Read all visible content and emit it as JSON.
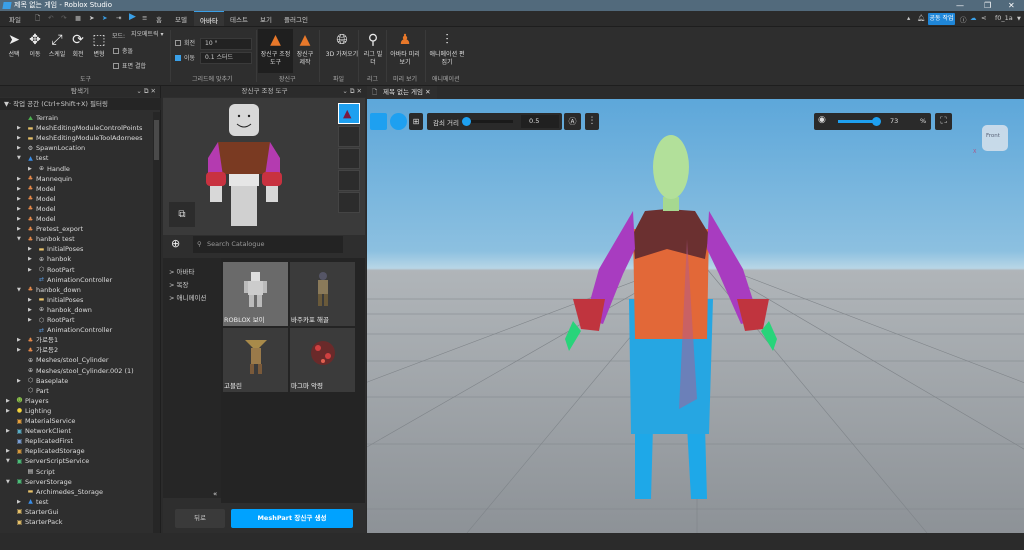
{
  "window": {
    "title": "제목 없는 게임 - Roblox Studio",
    "minimize": "—",
    "restore": "❐",
    "close": "✕"
  },
  "menu": {
    "file": "파일",
    "home": "홈",
    "tabs": [
      "모델",
      "아바타",
      "테스트",
      "보기",
      "플러그인"
    ],
    "active_tab": "아바타",
    "collab": "공동 작업",
    "user": "f0_1a"
  },
  "ribbon": {
    "tools": [
      "선택",
      "이동",
      "스케일",
      "회전",
      "변형"
    ],
    "mode_label": "모드:",
    "mode_value": "지오메트릭",
    "collision": "충돌",
    "surface_join": "표면 결합",
    "group_tools": "도구",
    "rotate_label": "회전",
    "rotate_value": "10 °",
    "rotate_checked": false,
    "move_label": "이동",
    "move_value": "0.1 스터드",
    "move_checked": true,
    "group_grid": "그리드에 맞추기",
    "accessory_fit": "장신구 조정 도구",
    "accessory_create": "장신구 제작",
    "group_accessory": "장신구",
    "import3d": "3D 가져오기",
    "group_file": "파일",
    "rig_builder": "리그 빌더",
    "group_rig": "리그",
    "avatar_preview": "아바타 미리 보기",
    "group_preview": "미리 보기",
    "anim_editor": "애니메이션 편집기",
    "group_anim": "애니메이션"
  },
  "explorer": {
    "title": "탐색기",
    "filter": "작업 공간 (Ctrl+Shift+X) 필터링",
    "items": [
      {
        "label": "Terrain",
        "level": 1,
        "arrow": "",
        "icon": "terrain",
        "color": "#4caf50"
      },
      {
        "label": "MeshEditingModuleControlPoints",
        "level": 1,
        "arrow": "right",
        "icon": "folder",
        "color": "#e8c26a"
      },
      {
        "label": "MeshEditingModuleToolAdornees",
        "level": 1,
        "arrow": "right",
        "icon": "folder",
        "color": "#e8c26a"
      },
      {
        "label": "SpawnLocation",
        "level": 1,
        "arrow": "right",
        "icon": "gear",
        "color": "#cccccc"
      },
      {
        "label": "test",
        "level": 1,
        "arrow": "down",
        "icon": "accessory",
        "color": "#3a8ee8"
      },
      {
        "label": "Handle",
        "level": 2,
        "arrow": "right",
        "icon": "mesh",
        "color": "#cccccc"
      },
      {
        "label": "Mannequin",
        "level": 1,
        "arrow": "right",
        "icon": "model",
        "color": "#e88a4a"
      },
      {
        "label": "Model",
        "level": 1,
        "arrow": "right",
        "icon": "model",
        "color": "#e88a4a"
      },
      {
        "label": "Model",
        "level": 1,
        "arrow": "right",
        "icon": "model",
        "color": "#e88a4a"
      },
      {
        "label": "Model",
        "level": 1,
        "arrow": "right",
        "icon": "model",
        "color": "#e88a4a"
      },
      {
        "label": "Model",
        "level": 1,
        "arrow": "right",
        "icon": "model",
        "color": "#e88a4a"
      },
      {
        "label": "Pretest_export",
        "level": 1,
        "arrow": "right",
        "icon": "model",
        "color": "#e88a4a"
      },
      {
        "label": "hanbok test",
        "level": 1,
        "arrow": "down",
        "icon": "model",
        "color": "#e88a4a"
      },
      {
        "label": "InitialPoses",
        "level": 2,
        "arrow": "right",
        "icon": "folder",
        "color": "#e8c26a"
      },
      {
        "label": "hanbok",
        "level": 2,
        "arrow": "right",
        "icon": "mesh",
        "color": "#cccccc"
      },
      {
        "label": "RootPart",
        "level": 2,
        "arrow": "right",
        "icon": "part",
        "color": "#cccccc"
      },
      {
        "label": "AnimationController",
        "level": 2,
        "arrow": "",
        "icon": "anim",
        "color": "#5a9ae0"
      },
      {
        "label": "hanbok_down",
        "level": 1,
        "arrow": "down",
        "icon": "model",
        "color": "#e88a4a"
      },
      {
        "label": "InitialPoses",
        "level": 2,
        "arrow": "right",
        "icon": "folder",
        "color": "#e8c26a"
      },
      {
        "label": "hanbok_down",
        "level": 2,
        "arrow": "right",
        "icon": "mesh",
        "color": "#cccccc"
      },
      {
        "label": "RootPart",
        "level": 2,
        "arrow": "right",
        "icon": "part",
        "color": "#cccccc"
      },
      {
        "label": "AnimationController",
        "level": 2,
        "arrow": "",
        "icon": "anim",
        "color": "#5a9ae0"
      },
      {
        "label": "가로등1",
        "level": 1,
        "arrow": "right",
        "icon": "model",
        "color": "#e88a4a"
      },
      {
        "label": "가로등2",
        "level": 1,
        "arrow": "right",
        "icon": "model",
        "color": "#e88a4a"
      },
      {
        "label": "Meshes/stool_Cylinder",
        "level": 1,
        "arrow": "",
        "icon": "mesh",
        "color": "#cccccc"
      },
      {
        "label": "Meshes/stool_Cylinder.002 (1)",
        "level": 1,
        "arrow": "",
        "icon": "mesh",
        "color": "#cccccc"
      },
      {
        "label": "Baseplate",
        "level": 1,
        "arrow": "right",
        "icon": "part",
        "color": "#cccccc"
      },
      {
        "label": "Part",
        "level": 1,
        "arrow": "",
        "icon": "part",
        "color": "#cccccc"
      },
      {
        "label": "Players",
        "level": 0,
        "arrow": "right",
        "icon": "players",
        "color": "#8bc34a"
      },
      {
        "label": "Lighting",
        "level": 0,
        "arrow": "right",
        "icon": "bulb",
        "color": "#f2d23c"
      },
      {
        "label": "MaterialService",
        "level": 0,
        "arrow": "",
        "icon": "service",
        "color": "#e8a23c"
      },
      {
        "label": "NetworkClient",
        "level": 0,
        "arrow": "right",
        "icon": "service",
        "color": "#5ab0c8"
      },
      {
        "label": "ReplicatedFirst",
        "level": 0,
        "arrow": "",
        "icon": "service",
        "color": "#7aa0d8"
      },
      {
        "label": "ReplicatedStorage",
        "level": 0,
        "arrow": "right",
        "icon": "service",
        "color": "#d89a3c"
      },
      {
        "label": "ServerScriptService",
        "level": 0,
        "arrow": "down",
        "icon": "service",
        "color": "#4cc07a"
      },
      {
        "label": "Script",
        "level": 1,
        "arrow": "",
        "icon": "script",
        "color": "#dddddd"
      },
      {
        "label": "ServerStorage",
        "level": 0,
        "arrow": "down",
        "icon": "service",
        "color": "#4cc07a"
      },
      {
        "label": "Archimedes_Storage",
        "level": 1,
        "arrow": "",
        "icon": "folder",
        "color": "#e8c26a"
      },
      {
        "label": "test",
        "level": 1,
        "arrow": "right",
        "icon": "accessory",
        "color": "#3a8ee8"
      },
      {
        "label": "StarterGui",
        "level": 0,
        "arrow": "",
        "icon": "service",
        "color": "#e8c26a"
      },
      {
        "label": "StarterPack",
        "level": 0,
        "arrow": "",
        "icon": "service",
        "color": "#e8c26a"
      }
    ]
  },
  "accessory_panel": {
    "title": "장신구 조정 도구",
    "search_placeholder": "Search Catalogue",
    "categories": [
      "아바타",
      "복장",
      "애니메이션"
    ],
    "cards": [
      "ROBLOX 보이",
      "바주카포 해골",
      "고블린",
      "마그마 악령"
    ],
    "collapse": "«",
    "back": "뒤로",
    "create": "MeshPart 장신구 생성"
  },
  "viewport": {
    "tab": "제목 없는 게임",
    "cage_distance_label": "감쇠 거리",
    "cage_distance_value": "0.5",
    "cage_distance_fraction": 0.05,
    "opacity_value": "73",
    "opacity_unit": "%",
    "opacity_fraction": 0.73,
    "gizmo_label": "Front",
    "axis_x": "X"
  },
  "colors": {
    "accent": "#00a2ff",
    "active_tab": "#3aa0e8"
  }
}
